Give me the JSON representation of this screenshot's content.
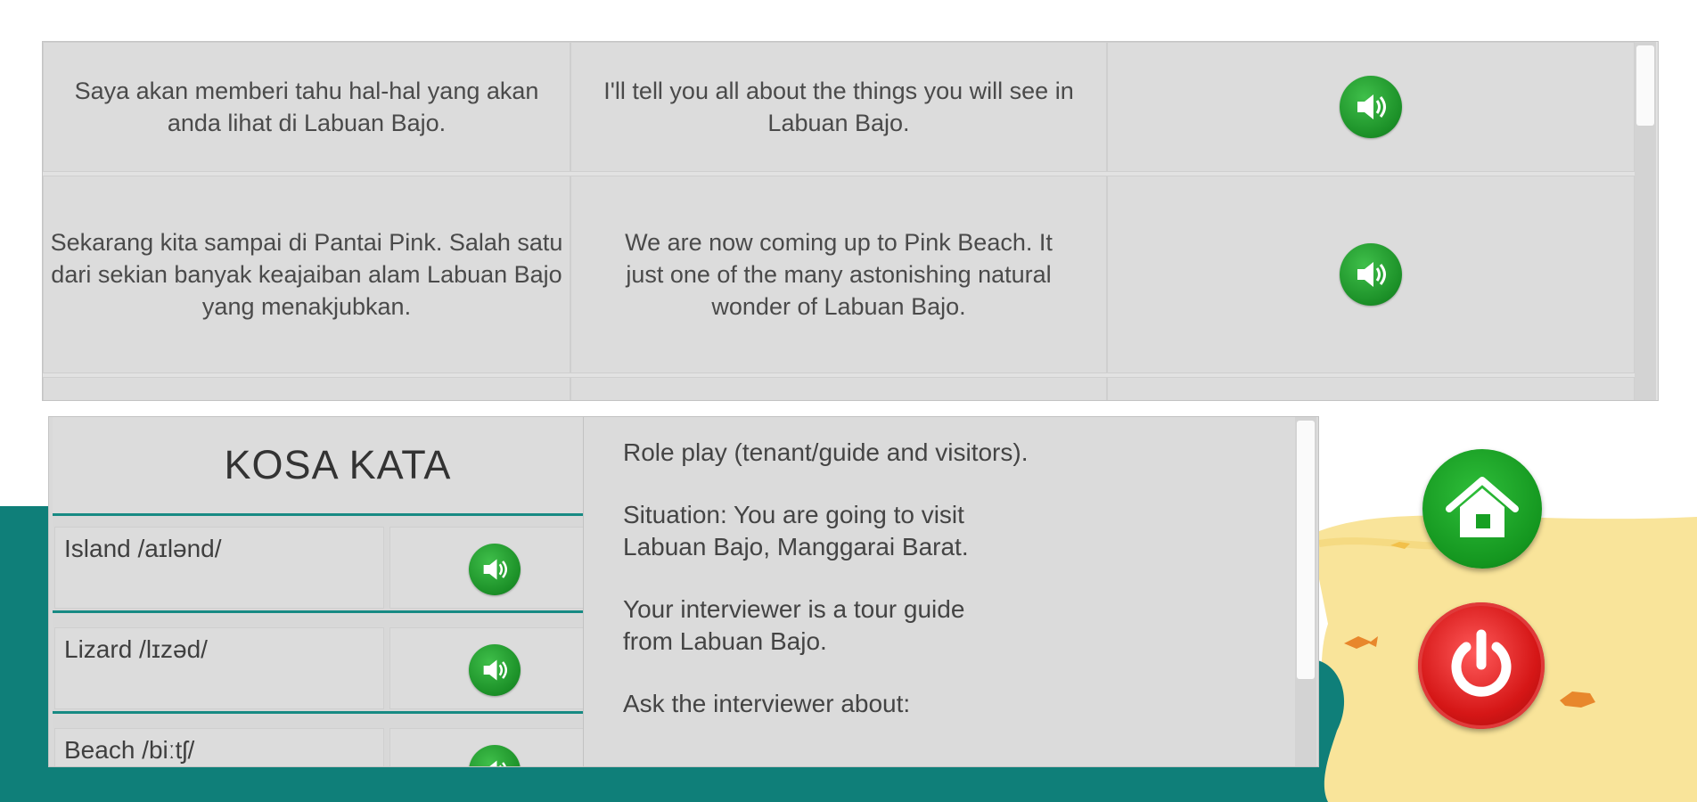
{
  "phrases": {
    "rows": [
      {
        "indonesian": "Saya akan memberi tahu hal-hal yang akan anda lihat di Labuan Bajo.",
        "english": "I'll tell you all about the things you will see in Labuan Bajo.",
        "sound_icon": "speaker-icon"
      },
      {
        "indonesian": "Sekarang kita sampai di Pantai Pink. Salah satu dari sekian banyak keajaiban alam Labuan Bajo yang menakjubkan.",
        "english": "We are now coming up to Pink Beach. It just one of the many astonishing natural wonder of Labuan Bajo.",
        "sound_icon": "speaker-icon"
      }
    ]
  },
  "vocabulary": {
    "title": "KOSA KATA",
    "items": [
      {
        "word": "Island /aɪlənd/",
        "sound_icon": "speaker-icon"
      },
      {
        "word": "Lizard /lɪzəd/",
        "sound_icon": "speaker-icon"
      },
      {
        "word": "Beach /biːtʃ/",
        "sound_icon": "speaker-icon"
      }
    ]
  },
  "roleplay": {
    "paragraphs": [
      "Role play (tenant/guide and visitors).",
      "Situation: You are going to visit\nLabuan Bajo, Manggarai Barat.",
      "Your interviewer is a tour guide\nfrom Labuan Bajo.",
      "Ask the interviewer about:"
    ]
  },
  "buttons": {
    "home_icon": "home-icon",
    "power_icon": "power-icon"
  },
  "colors": {
    "teal": "#0f7f79",
    "sand": "#f7df8a",
    "speaker_green": "#1f9a2b",
    "home_green": "#17a023",
    "power_red": "#d81a1a"
  }
}
